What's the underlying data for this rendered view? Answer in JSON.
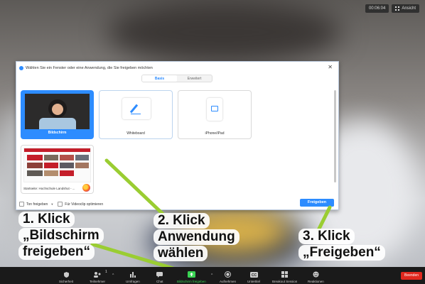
{
  "top": {
    "timer": "00:06:04",
    "view_label": "Ansicht"
  },
  "dialog": {
    "title": "Wählen Sie ein Fenster oder eine Anwendung, die Sie freigeben möchten",
    "tabs": [
      {
        "label": "Basis",
        "active": true
      },
      {
        "label": "Erweitert",
        "active": false
      }
    ],
    "tiles": [
      {
        "label": "Bildschirm",
        "selected": true
      },
      {
        "label": "Whiteboard",
        "selected": false
      },
      {
        "label": "iPhone/iPad",
        "selected": false
      },
      {
        "label": "Startseite: Hochschule Landshut - ...",
        "selected": false
      }
    ],
    "options": {
      "sound_label": "Ton freigeben",
      "video_label": "Für Videoclip optimieren"
    },
    "share_button": "Freigeben"
  },
  "annotations": {
    "step1": [
      "1. Klick",
      "„Bildschirm",
      "freigeben“"
    ],
    "step2": [
      "2. Klick",
      "Anwendung",
      "wählen"
    ],
    "step3": [
      "3. Klick",
      "„Freigeben“"
    ]
  },
  "toolbar": {
    "items": [
      {
        "label": "Sicherheit",
        "icon": "shield-icon"
      },
      {
        "label": "Teilnehmer",
        "icon": "participants-icon",
        "count": "1"
      },
      {
        "label": "Umfragen",
        "icon": "polls-icon"
      },
      {
        "label": "Chat",
        "icon": "chat-icon"
      },
      {
        "label": "Bildschirm freigeben",
        "icon": "share-screen-icon",
        "active": true
      },
      {
        "label": "Aufnehmen",
        "icon": "record-icon"
      },
      {
        "label": "Untertitel",
        "icon": "cc-icon"
      },
      {
        "label": "Breakout Session",
        "icon": "breakout-icon"
      },
      {
        "label": "Reaktionen",
        "icon": "reactions-icon"
      }
    ],
    "end_button": "Beenden"
  },
  "colors": {
    "accent": "#2d8cff",
    "share_green": "#39d353",
    "end_red": "#e0281e",
    "arrow_green": "#9acd32"
  }
}
